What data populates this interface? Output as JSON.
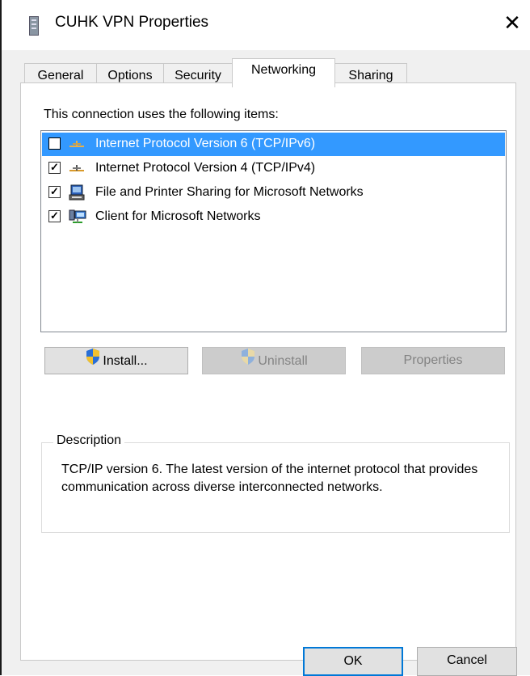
{
  "window": {
    "title": "CUHK VPN Properties",
    "close_glyph": "✕"
  },
  "tabs": [
    {
      "label": "General",
      "active": false
    },
    {
      "label": "Options",
      "active": false
    },
    {
      "label": "Security",
      "active": false
    },
    {
      "label": "Networking",
      "active": true
    },
    {
      "label": "Sharing",
      "active": false
    }
  ],
  "networking": {
    "intro": "This connection uses the following items:",
    "items": [
      {
        "label": "Internet Protocol Version 6 (TCP/IPv6)",
        "checked": false,
        "selected": true,
        "icon": "network-protocol-icon"
      },
      {
        "label": "Internet Protocol Version 4 (TCP/IPv4)",
        "checked": true,
        "selected": false,
        "icon": "network-protocol-icon"
      },
      {
        "label": "File and Printer Sharing for Microsoft Networks",
        "checked": true,
        "selected": false,
        "icon": "printer-sharing-icon"
      },
      {
        "label": "Client for Microsoft Networks",
        "checked": true,
        "selected": false,
        "icon": "network-client-icon"
      }
    ],
    "buttons": {
      "install": "Install...",
      "uninstall": "Uninstall",
      "properties": "Properties"
    },
    "description_legend": "Description",
    "description_text": "TCP/IP version 6. The latest version of the internet protocol that provides communication across diverse interconnected networks."
  },
  "dialog_buttons": {
    "ok": "OK",
    "cancel": "Cancel"
  },
  "colors": {
    "selection": "#3399ff",
    "default_button_border": "#0078d7",
    "dialog_background": "#f0f0f0"
  }
}
